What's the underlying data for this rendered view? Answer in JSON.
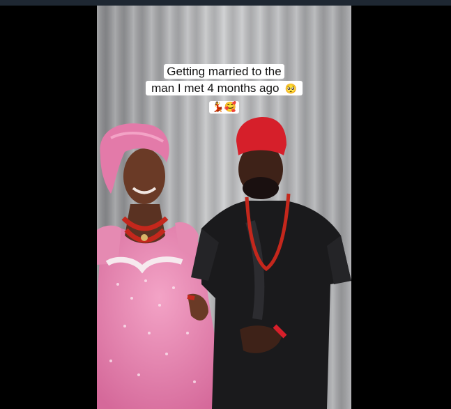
{
  "video": {
    "caption_line1": "Getting married to the",
    "caption_line2": "man I met 4 months ago",
    "caption_emoji_1": "🥺",
    "caption_emoji_2": "💃🥰"
  },
  "colors": {
    "background": "#000000",
    "curtain": "#b9babd",
    "dress_pink": "#e37aa9",
    "agbada_black": "#1a1a1c",
    "cap_red": "#d61f2a",
    "coral_beads": "#c4271c"
  }
}
